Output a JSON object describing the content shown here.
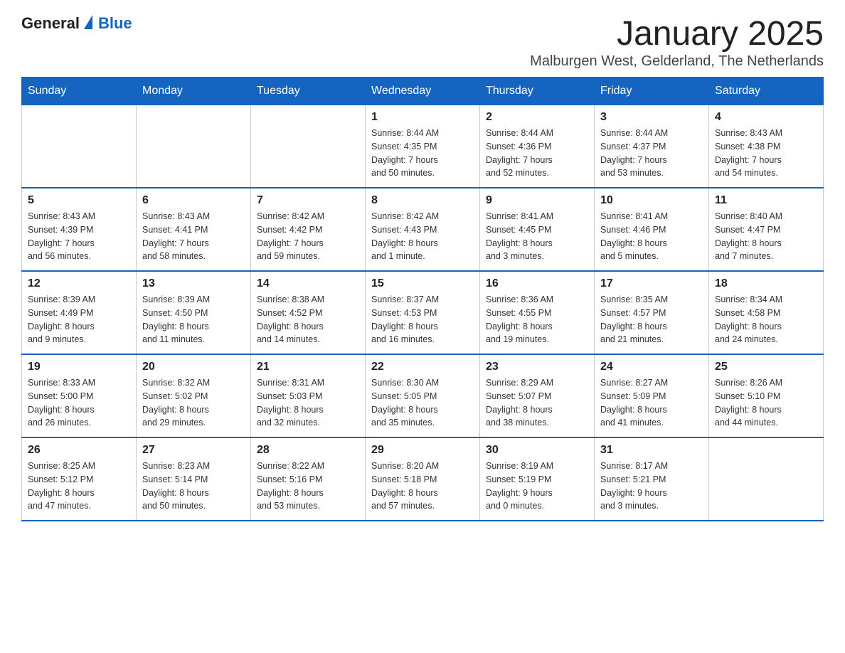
{
  "logo": {
    "text_general": "General",
    "text_blue": "Blue"
  },
  "header": {
    "month_year": "January 2025",
    "location": "Malburgen West, Gelderland, The Netherlands"
  },
  "weekdays": [
    "Sunday",
    "Monday",
    "Tuesday",
    "Wednesday",
    "Thursday",
    "Friday",
    "Saturday"
  ],
  "weeks": [
    [
      {
        "day": "",
        "info": ""
      },
      {
        "day": "",
        "info": ""
      },
      {
        "day": "",
        "info": ""
      },
      {
        "day": "1",
        "info": "Sunrise: 8:44 AM\nSunset: 4:35 PM\nDaylight: 7 hours\nand 50 minutes."
      },
      {
        "day": "2",
        "info": "Sunrise: 8:44 AM\nSunset: 4:36 PM\nDaylight: 7 hours\nand 52 minutes."
      },
      {
        "day": "3",
        "info": "Sunrise: 8:44 AM\nSunset: 4:37 PM\nDaylight: 7 hours\nand 53 minutes."
      },
      {
        "day": "4",
        "info": "Sunrise: 8:43 AM\nSunset: 4:38 PM\nDaylight: 7 hours\nand 54 minutes."
      }
    ],
    [
      {
        "day": "5",
        "info": "Sunrise: 8:43 AM\nSunset: 4:39 PM\nDaylight: 7 hours\nand 56 minutes."
      },
      {
        "day": "6",
        "info": "Sunrise: 8:43 AM\nSunset: 4:41 PM\nDaylight: 7 hours\nand 58 minutes."
      },
      {
        "day": "7",
        "info": "Sunrise: 8:42 AM\nSunset: 4:42 PM\nDaylight: 7 hours\nand 59 minutes."
      },
      {
        "day": "8",
        "info": "Sunrise: 8:42 AM\nSunset: 4:43 PM\nDaylight: 8 hours\nand 1 minute."
      },
      {
        "day": "9",
        "info": "Sunrise: 8:41 AM\nSunset: 4:45 PM\nDaylight: 8 hours\nand 3 minutes."
      },
      {
        "day": "10",
        "info": "Sunrise: 8:41 AM\nSunset: 4:46 PM\nDaylight: 8 hours\nand 5 minutes."
      },
      {
        "day": "11",
        "info": "Sunrise: 8:40 AM\nSunset: 4:47 PM\nDaylight: 8 hours\nand 7 minutes."
      }
    ],
    [
      {
        "day": "12",
        "info": "Sunrise: 8:39 AM\nSunset: 4:49 PM\nDaylight: 8 hours\nand 9 minutes."
      },
      {
        "day": "13",
        "info": "Sunrise: 8:39 AM\nSunset: 4:50 PM\nDaylight: 8 hours\nand 11 minutes."
      },
      {
        "day": "14",
        "info": "Sunrise: 8:38 AM\nSunset: 4:52 PM\nDaylight: 8 hours\nand 14 minutes."
      },
      {
        "day": "15",
        "info": "Sunrise: 8:37 AM\nSunset: 4:53 PM\nDaylight: 8 hours\nand 16 minutes."
      },
      {
        "day": "16",
        "info": "Sunrise: 8:36 AM\nSunset: 4:55 PM\nDaylight: 8 hours\nand 19 minutes."
      },
      {
        "day": "17",
        "info": "Sunrise: 8:35 AM\nSunset: 4:57 PM\nDaylight: 8 hours\nand 21 minutes."
      },
      {
        "day": "18",
        "info": "Sunrise: 8:34 AM\nSunset: 4:58 PM\nDaylight: 8 hours\nand 24 minutes."
      }
    ],
    [
      {
        "day": "19",
        "info": "Sunrise: 8:33 AM\nSunset: 5:00 PM\nDaylight: 8 hours\nand 26 minutes."
      },
      {
        "day": "20",
        "info": "Sunrise: 8:32 AM\nSunset: 5:02 PM\nDaylight: 8 hours\nand 29 minutes."
      },
      {
        "day": "21",
        "info": "Sunrise: 8:31 AM\nSunset: 5:03 PM\nDaylight: 8 hours\nand 32 minutes."
      },
      {
        "day": "22",
        "info": "Sunrise: 8:30 AM\nSunset: 5:05 PM\nDaylight: 8 hours\nand 35 minutes."
      },
      {
        "day": "23",
        "info": "Sunrise: 8:29 AM\nSunset: 5:07 PM\nDaylight: 8 hours\nand 38 minutes."
      },
      {
        "day": "24",
        "info": "Sunrise: 8:27 AM\nSunset: 5:09 PM\nDaylight: 8 hours\nand 41 minutes."
      },
      {
        "day": "25",
        "info": "Sunrise: 8:26 AM\nSunset: 5:10 PM\nDaylight: 8 hours\nand 44 minutes."
      }
    ],
    [
      {
        "day": "26",
        "info": "Sunrise: 8:25 AM\nSunset: 5:12 PM\nDaylight: 8 hours\nand 47 minutes."
      },
      {
        "day": "27",
        "info": "Sunrise: 8:23 AM\nSunset: 5:14 PM\nDaylight: 8 hours\nand 50 minutes."
      },
      {
        "day": "28",
        "info": "Sunrise: 8:22 AM\nSunset: 5:16 PM\nDaylight: 8 hours\nand 53 minutes."
      },
      {
        "day": "29",
        "info": "Sunrise: 8:20 AM\nSunset: 5:18 PM\nDaylight: 8 hours\nand 57 minutes."
      },
      {
        "day": "30",
        "info": "Sunrise: 8:19 AM\nSunset: 5:19 PM\nDaylight: 9 hours\nand 0 minutes."
      },
      {
        "day": "31",
        "info": "Sunrise: 8:17 AM\nSunset: 5:21 PM\nDaylight: 9 hours\nand 3 minutes."
      },
      {
        "day": "",
        "info": ""
      }
    ]
  ]
}
